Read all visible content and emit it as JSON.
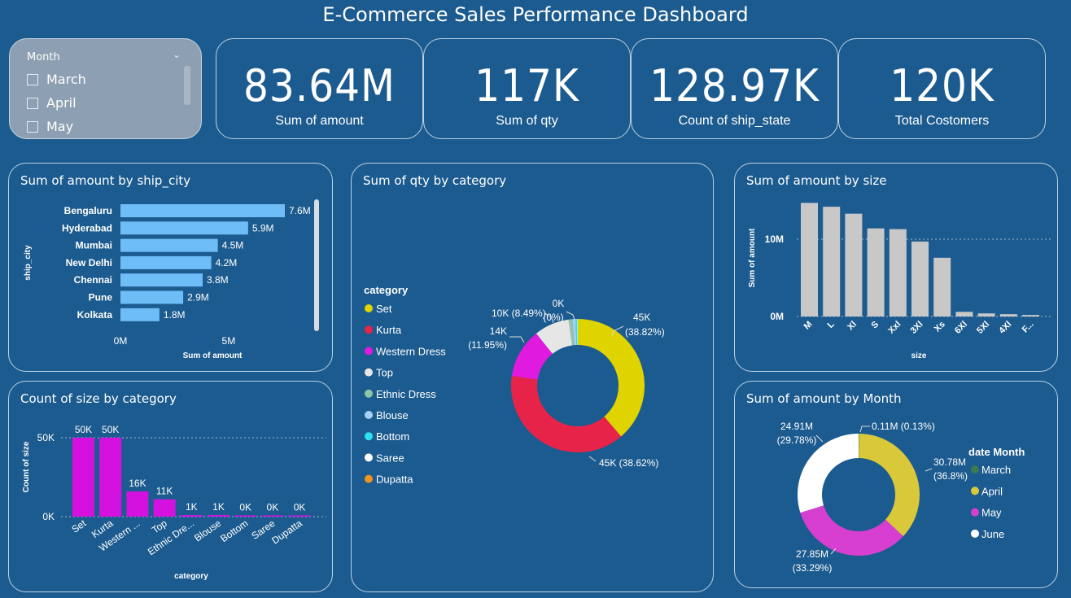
{
  "title": "E-Commerce Sales Performance Dashboard",
  "slicer": {
    "header": "Month",
    "items": [
      "March",
      "April",
      "May"
    ]
  },
  "kpis": [
    {
      "value": "83.64M",
      "label": "Sum of amount"
    },
    {
      "value": "117K",
      "label": "Sum of qty"
    },
    {
      "value": "128.97K",
      "label": "Count of ship_state"
    },
    {
      "value": "120K",
      "label": "Total Costomers"
    }
  ],
  "colors": {
    "background": "#1c5b8f",
    "city_bar": "#6fbdf7",
    "size_bar": "#c8c8c8",
    "category_bar": "#d511e0"
  },
  "chart_data": [
    {
      "type": "bar",
      "orientation": "horizontal",
      "title": "Sum of amount by ship_city",
      "xlabel": "Sum of amount",
      "ylabel": "ship_city",
      "categories": [
        "Bengaluru",
        "Hyderabad",
        "Mumbai",
        "New Delhi",
        "Chennai",
        "Pune",
        "Kolkata"
      ],
      "values": [
        7.6,
        5.9,
        4.5,
        4.2,
        3.8,
        2.9,
        1.8
      ],
      "data_labels": [
        "7.6M",
        "5.9M",
        "4.5M",
        "4.2M",
        "3.8M",
        "2.9M",
        "1.8M"
      ],
      "xticks": [
        "0M",
        "5M"
      ],
      "xlim": [
        0,
        9.8
      ]
    },
    {
      "type": "pie",
      "title": "Sum of qty by category",
      "legend_title": "category",
      "legend_position": "left",
      "categories": [
        "Set",
        "Kurta",
        "Western Dress",
        "Top",
        "Ethnic Dress",
        "Blouse",
        "Bottom",
        "Saree",
        "Dupatta"
      ],
      "values": [
        45.35,
        45.12,
        13.96,
        9.92,
        1.05,
        0.93,
        0.44,
        0.16,
        0.003
      ],
      "colors": [
        "#dfd300",
        "#e8234a",
        "#e01adf",
        "#e6e6e6",
        "#8fc6a6",
        "#a8cff7",
        "#2ee0f0",
        "#ffffff",
        "#f0941f"
      ],
      "data_labels": [
        {
          "value": "45K",
          "percent": "(38.82%)"
        },
        {
          "value": "45K",
          "percent": "(38.62%)"
        },
        {
          "value": "14K",
          "percent": "(11.95%)"
        },
        {
          "value": "10K",
          "percent": "(8.49%)"
        },
        {
          "value": "0K",
          "percent": "(0%)"
        }
      ]
    },
    {
      "type": "bar",
      "title": "Sum of amount by size",
      "xlabel": "size",
      "ylabel": "Sum of amount",
      "categories": [
        "M",
        "L",
        "Xl",
        "S",
        "Xxl",
        "3Xl",
        "Xs",
        "6Xl",
        "5Xl",
        "4Xl",
        "F..."
      ],
      "values": [
        14.7,
        14.2,
        13.3,
        11.4,
        11.3,
        9.7,
        7.6,
        0.6,
        0.4,
        0.3,
        0.2
      ],
      "yticks": [
        "0M",
        "10M"
      ],
      "ylim": [
        0,
        15.5
      ]
    },
    {
      "type": "bar",
      "title": "Count of size by category",
      "xlabel": "category",
      "ylabel": "Count of size",
      "categories": [
        "Set",
        "Kurta",
        "Western ...",
        "Top",
        "Ethnic Dre...",
        "Blouse",
        "Bottom",
        "Saree",
        "Dupatta"
      ],
      "values": [
        50,
        50,
        16,
        11,
        1,
        1,
        0.4,
        0.2,
        0.1
      ],
      "data_labels": [
        "50K",
        "50K",
        "16K",
        "11K",
        "1K",
        "1K",
        "0K",
        "0K",
        "0K"
      ],
      "yticks": [
        "0K",
        "50K"
      ],
      "ylim": [
        0,
        50
      ]
    },
    {
      "type": "pie",
      "title": "Sum of amount by Month",
      "legend_title": "date Month",
      "legend_position": "right",
      "categories": [
        "March",
        "April",
        "May",
        "June"
      ],
      "values": [
        0.11,
        30.78,
        27.85,
        24.91
      ],
      "colors": [
        "#3d7a4f",
        "#d9c93a",
        "#d63fd0",
        "#ffffff"
      ],
      "data_labels": [
        {
          "value": "0.11M",
          "percent": "(0.13%)"
        },
        {
          "value": "30.78M",
          "percent": "(36.8%)"
        },
        {
          "value": "27.85M",
          "percent": "(33.29%)"
        },
        {
          "value": "24.91M",
          "percent": "(29.78%)"
        }
      ]
    }
  ]
}
